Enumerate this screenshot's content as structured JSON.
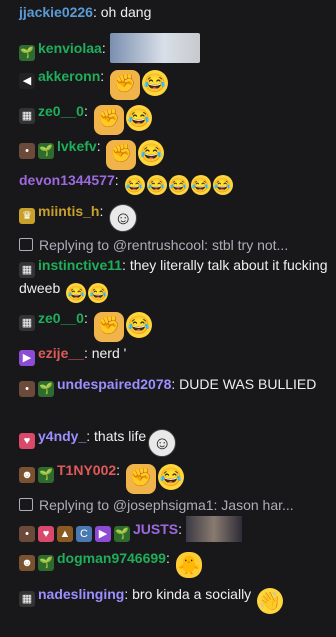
{
  "messages": [
    {
      "user": "jjackie0226",
      "color": "#5b9bd5",
      "text": "oh dang",
      "badges": [],
      "emotes": []
    },
    {
      "user": "kenviolaa",
      "color": "#1fae5a",
      "text": "",
      "badges": [
        "plant"
      ],
      "emotes": [
        "image"
      ]
    },
    {
      "user": "akkeronn",
      "color": "#1fae5a",
      "text": "",
      "badges": [
        "mute"
      ],
      "emotes": [
        "fist",
        "laugh"
      ]
    },
    {
      "user": "ze0__0",
      "color": "#1fae5a",
      "text": "",
      "badges": [
        "glitch"
      ],
      "emotes": [
        "fist",
        "laugh"
      ]
    },
    {
      "user": "lvkefv",
      "color": "#1fae5a",
      "text": "",
      "badges": [
        "bear",
        "plant"
      ],
      "emotes": [
        "fist",
        "laugh"
      ]
    },
    {
      "user": "devon1344577",
      "color": "#9c6ade",
      "text": "",
      "badges": [],
      "emotes": [
        "laugh",
        "laugh",
        "laugh",
        "laugh",
        "laugh"
      ]
    },
    {
      "user": "miintis_h",
      "color": "#c8a02c",
      "text": "",
      "badges": [
        "gold"
      ],
      "emotes": [
        "troll"
      ]
    },
    {
      "reply_to": "Replying to @rentrushcool: stbl try not..."
    },
    {
      "user": "instinctive11",
      "color": "#1fae5a",
      "text": "they literally talk about it fucking dweeb",
      "badges": [
        "glitch"
      ],
      "emotes": [
        "laugh",
        "laugh"
      ]
    },
    {
      "user": "ze0__0",
      "color": "#1fae5a",
      "text": "",
      "badges": [
        "glitch"
      ],
      "emotes": [
        "fist",
        "laugh"
      ]
    },
    {
      "user": "ezije__",
      "color": "#e05a5a",
      "text": "nerd '",
      "badges": [
        "purple"
      ],
      "emotes": []
    },
    {
      "user": "undespaired2078",
      "color": "#9c8fff",
      "text": "DUDE WAS BULLIED",
      "badges": [
        "bear",
        "plant"
      ],
      "emotes": []
    },
    {
      "user": "y4ndy_",
      "color": "#9c8fff",
      "text": "thats life",
      "badges": [
        "heart"
      ],
      "emotes": [
        "troll"
      ]
    },
    {
      "user": "T1NY002",
      "color": "#e05a5a",
      "text": "",
      "badges": [
        "person",
        "plant"
      ],
      "emotes": [
        "fist",
        "laugh"
      ]
    },
    {
      "reply_to": "Replying to @josephsigma1: Jason har..."
    },
    {
      "user": "JUSTS",
      "color": "#9c6ade",
      "text": "",
      "badges": [
        "bear",
        "heart",
        "brown",
        "c",
        "purple",
        "plant"
      ],
      "emotes": [
        "image2"
      ]
    },
    {
      "user": "dogman9746699",
      "color": "#1fae5a",
      "text": "",
      "badges": [
        "person",
        "plant"
      ],
      "emotes": [
        "duck"
      ]
    },
    {
      "user": "nadeslinging",
      "color": "#9c8fff",
      "text": "bro kinda a socially",
      "badges": [
        "glitch"
      ],
      "emotes": [
        "hand"
      ]
    }
  ]
}
